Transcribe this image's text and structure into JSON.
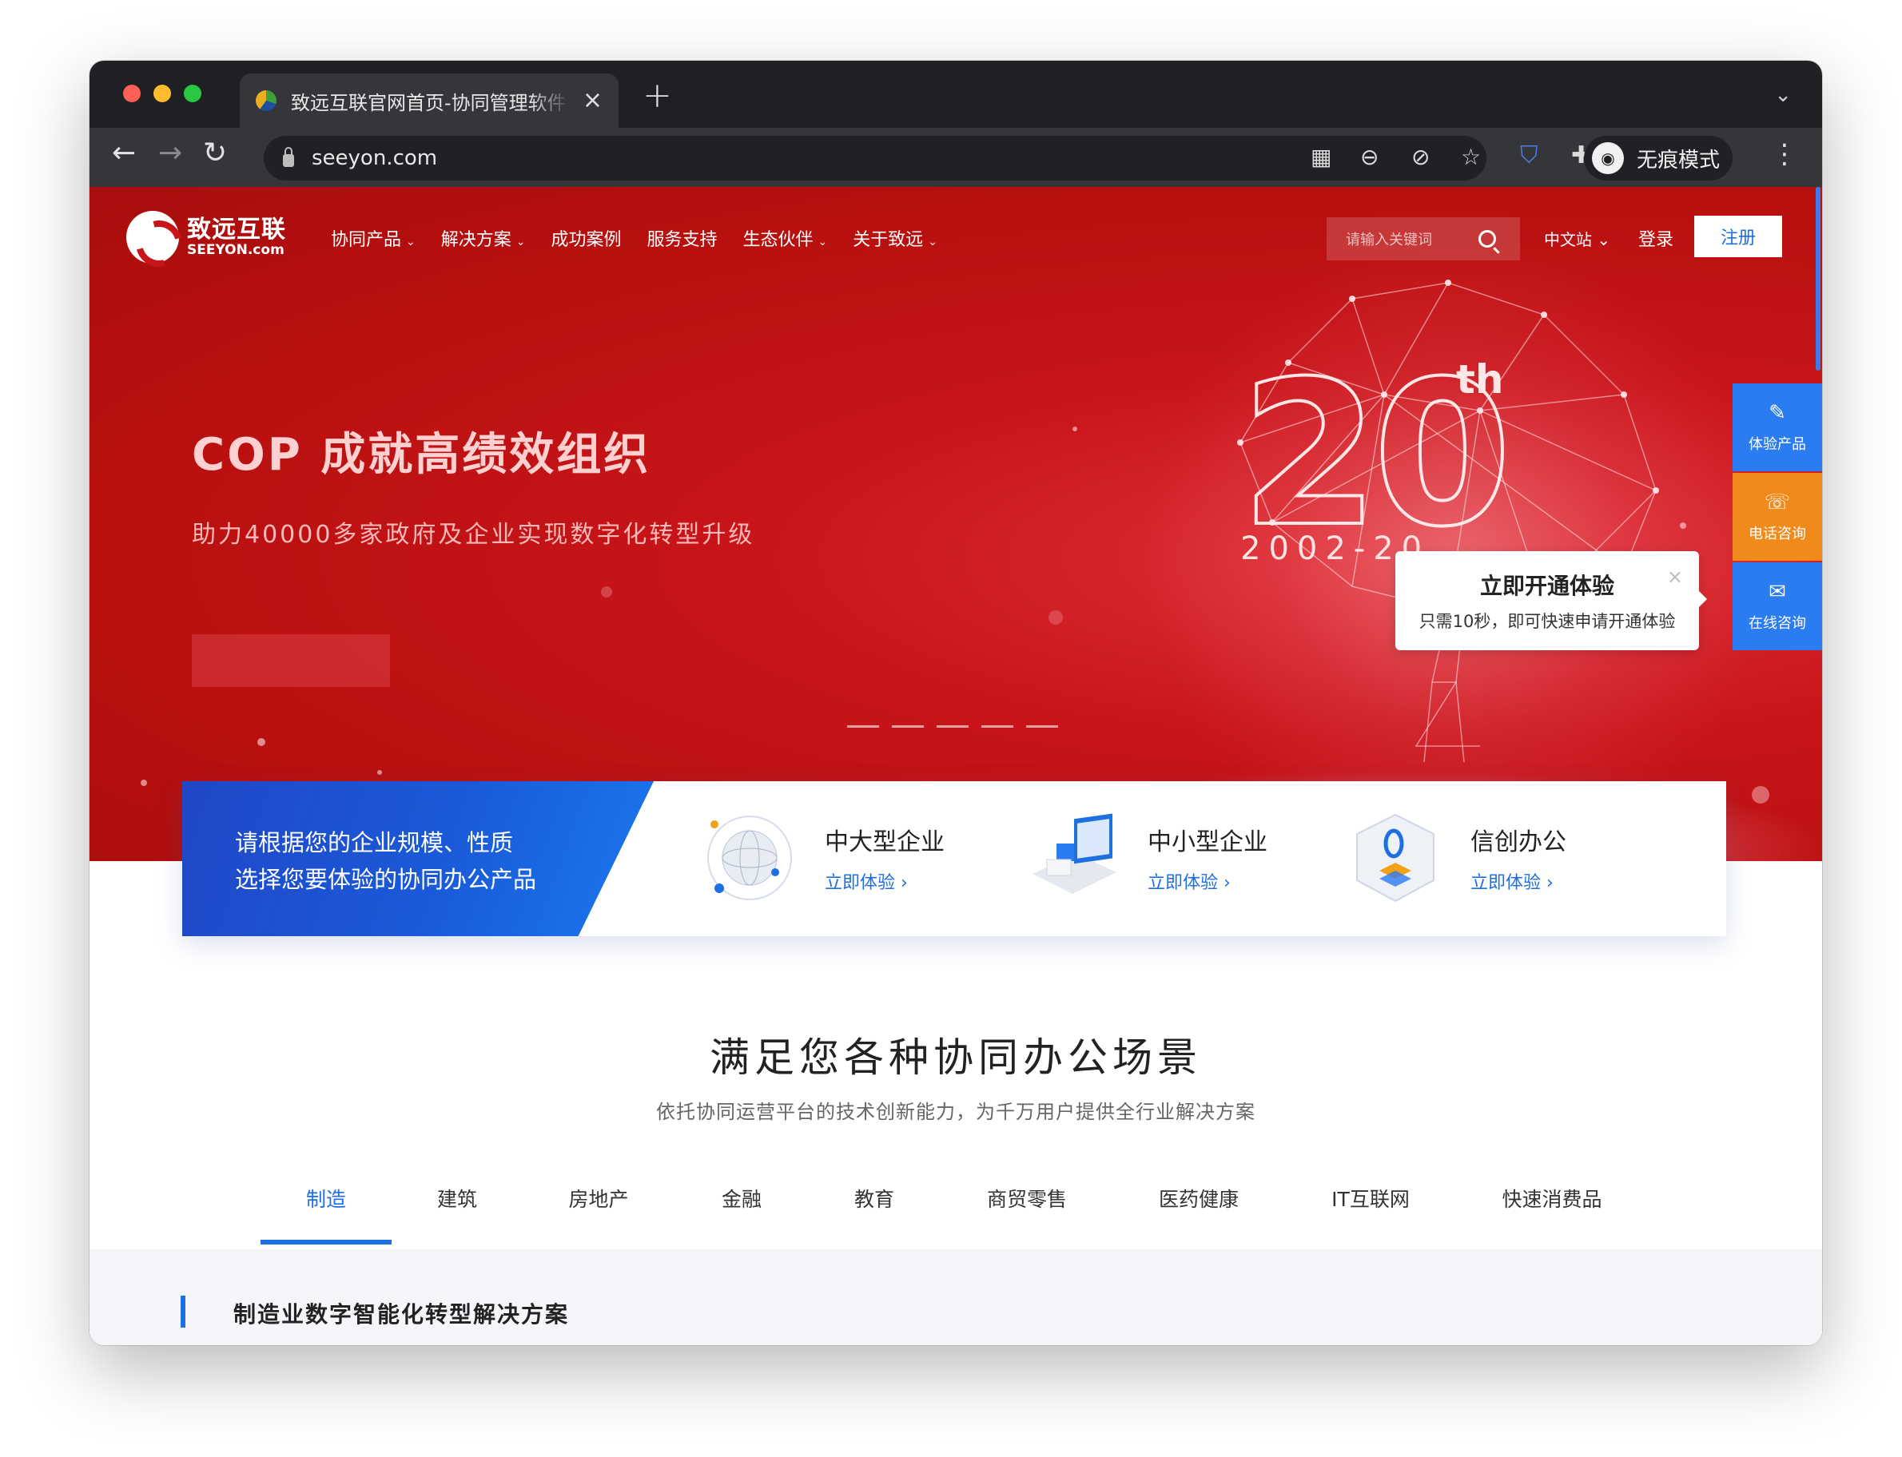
{
  "browser": {
    "tab_title": "致远互联官网首页-协同管理软件",
    "new_tab_symbol": "+",
    "url": "seeyon.com",
    "incognito_label": "无痕模式"
  },
  "header": {
    "logo_cn": "致远互联",
    "logo_en": "SEEYON.com",
    "nav": [
      {
        "label": "协同产品",
        "caret": "⌄"
      },
      {
        "label": "解决方案",
        "caret": "⌄"
      },
      {
        "label": "成功案例",
        "caret": ""
      },
      {
        "label": "服务支持",
        "caret": ""
      },
      {
        "label": "生态伙伴",
        "caret": "⌄"
      },
      {
        "label": "关于致远",
        "caret": "⌄"
      }
    ],
    "search_placeholder": "请输入关键词",
    "lang_label": "中文站 ⌄",
    "login_label": "登录",
    "register_label": "注册"
  },
  "hero": {
    "title": "COP 成就高绩效组织",
    "subtitle": "助力40000多家政府及企业实现数字化转型升级",
    "anniversary_number": "20",
    "anniversary_suffix": "th",
    "anniversary_years": "2002-20"
  },
  "popup": {
    "title": "立即开通体验",
    "description": "只需10秒，即可快速申请开通体验",
    "close": "×"
  },
  "side_buttons": [
    {
      "label": "体验产品",
      "icon": "edit-icon",
      "color": "#2a7cf0"
    },
    {
      "label": "电话咨询",
      "icon": "phone-24-icon",
      "color": "#f08a1b"
    },
    {
      "label": "在线咨询",
      "icon": "chat-icon",
      "color": "#2a7cf0"
    }
  ],
  "selector": {
    "prompt_line1": "请根据您的企业规模、性质",
    "prompt_line2": "选择您要体验的协同办公产品",
    "items": [
      {
        "name": "中大型企业",
        "link": "立即体验 ›"
      },
      {
        "name": "中小型企业",
        "link": "立即体验 ›"
      },
      {
        "name": "信创办公",
        "link": "立即体验 ›"
      }
    ]
  },
  "section": {
    "title": "满足您各种协同办公场景",
    "subtitle": "依托协同运营平台的技术创新能力，为千万用户提供全行业解决方案",
    "tabs": [
      "制造",
      "建筑",
      "房地产",
      "金融",
      "教育",
      "商贸零售",
      "医药健康",
      "IT互联网",
      "快速消费品"
    ],
    "active_tab": "制造",
    "panel_title": "制造业数字智能化转型解决方案"
  },
  "colors": {
    "brand_red": "#c8151a",
    "accent_blue": "#1e6fe0",
    "consult_orange": "#f08a1b"
  }
}
